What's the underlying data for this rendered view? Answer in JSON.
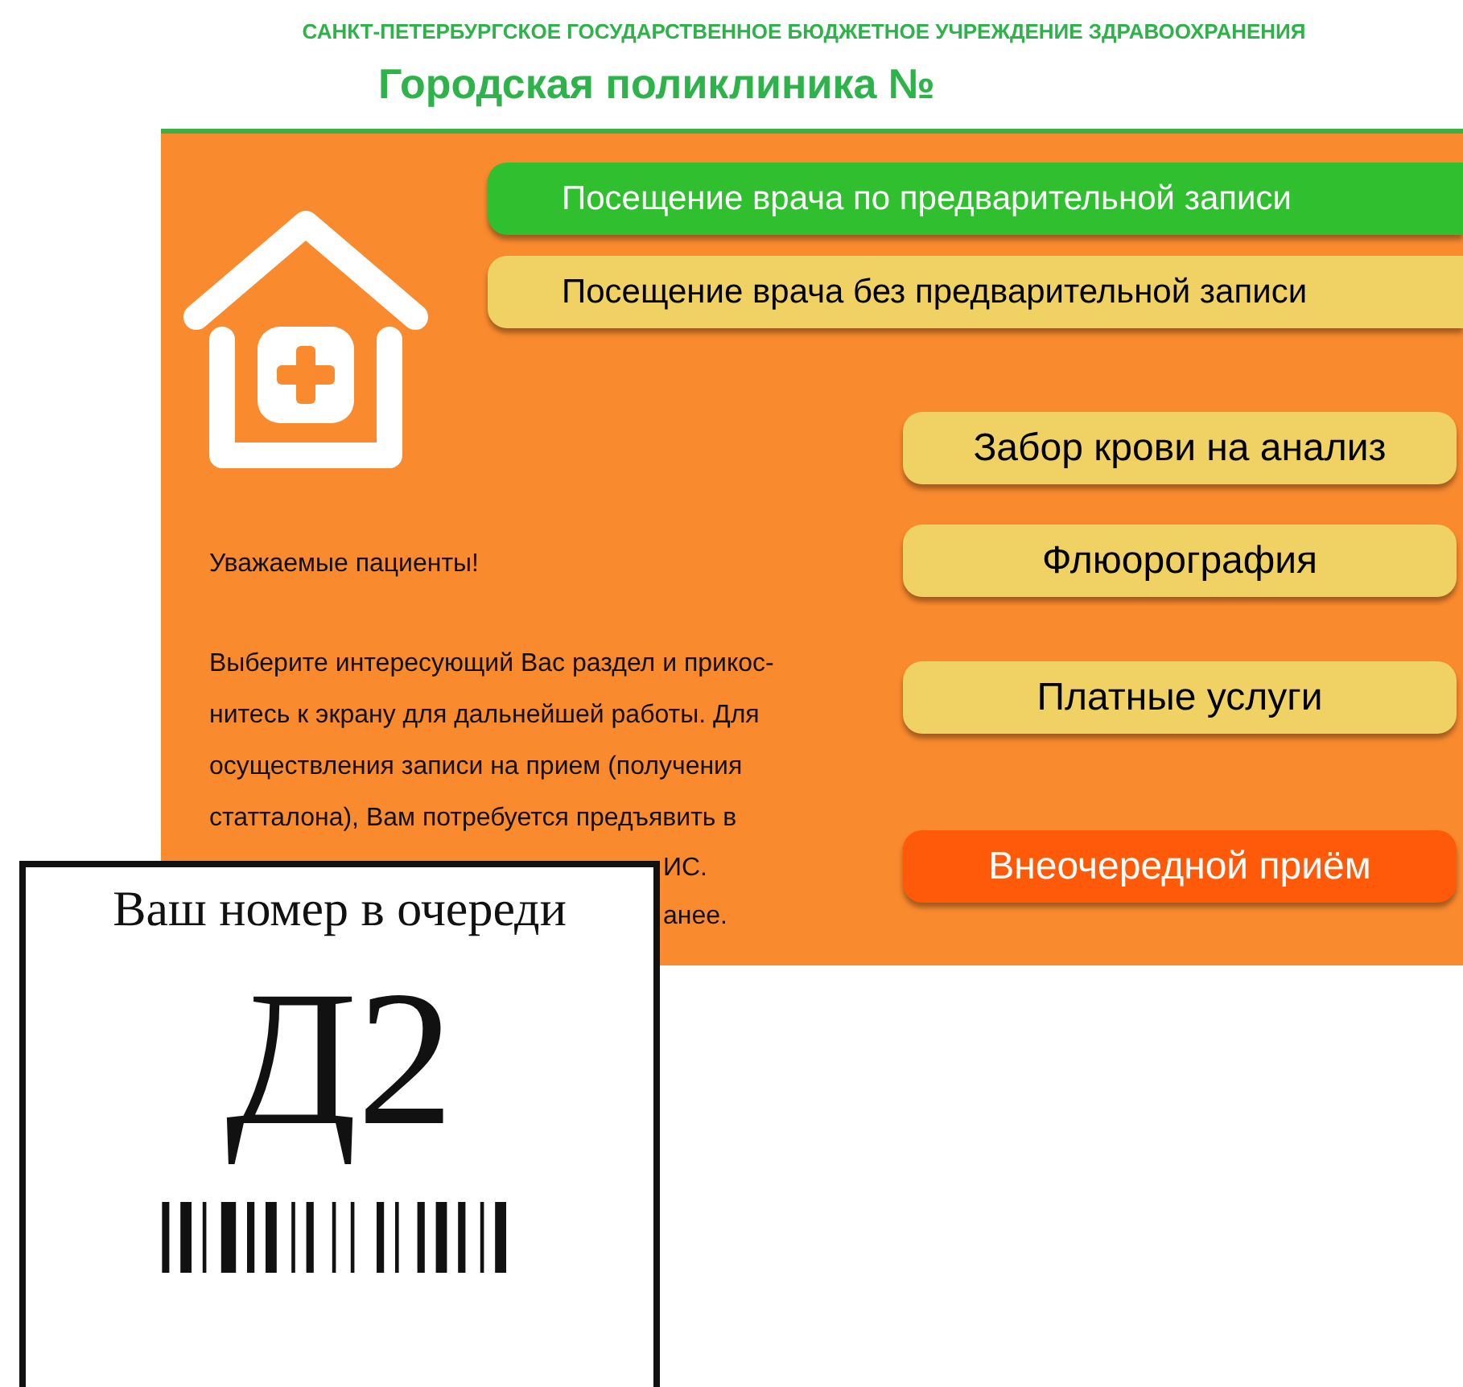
{
  "header": {
    "organization": "САНКТ-ПЕТЕРБУРГСКОЕ ГОСУДАРСТВЕННОЕ БЮДЖЕТНОЕ УЧРЕЖДЕНИЕ ЗДРАВООХРАНЕНИЯ",
    "title": "Городская поликлиника №"
  },
  "menu_buttons": [
    {
      "label": "Посещение врача по предварительной записи",
      "color": "#2fbf2f",
      "kind": "wide"
    },
    {
      "label": "Посещение врача без предварительной записи",
      "color": "#f0d264",
      "kind": "wide"
    },
    {
      "label": "Забор крови на анализ",
      "color": "#f0d264",
      "kind": "narrow"
    },
    {
      "label": "Флюорография",
      "color": "#f0d264",
      "kind": "narrow"
    },
    {
      "label": "Платные услуги",
      "color": "#f0d264",
      "kind": "narrow"
    },
    {
      "label": "Внеочередной приём",
      "color": "#ff5a0a",
      "kind": "narrow"
    }
  ],
  "notice": {
    "heading": "Уважаемые пациенты!",
    "lines": [
      "Выберите интересующий Вас раздел и прикос-",
      "нитесь к экрану для дальнейшей работы. Для",
      "осуществления записи на прием (получения",
      "статталона), Вам потребуется предъявить в"
    ],
    "covered_fragments": [
      "ИС.",
      "анее."
    ]
  },
  "ticket": {
    "caption": "Ваш номер в очереди",
    "number": "Д2"
  }
}
